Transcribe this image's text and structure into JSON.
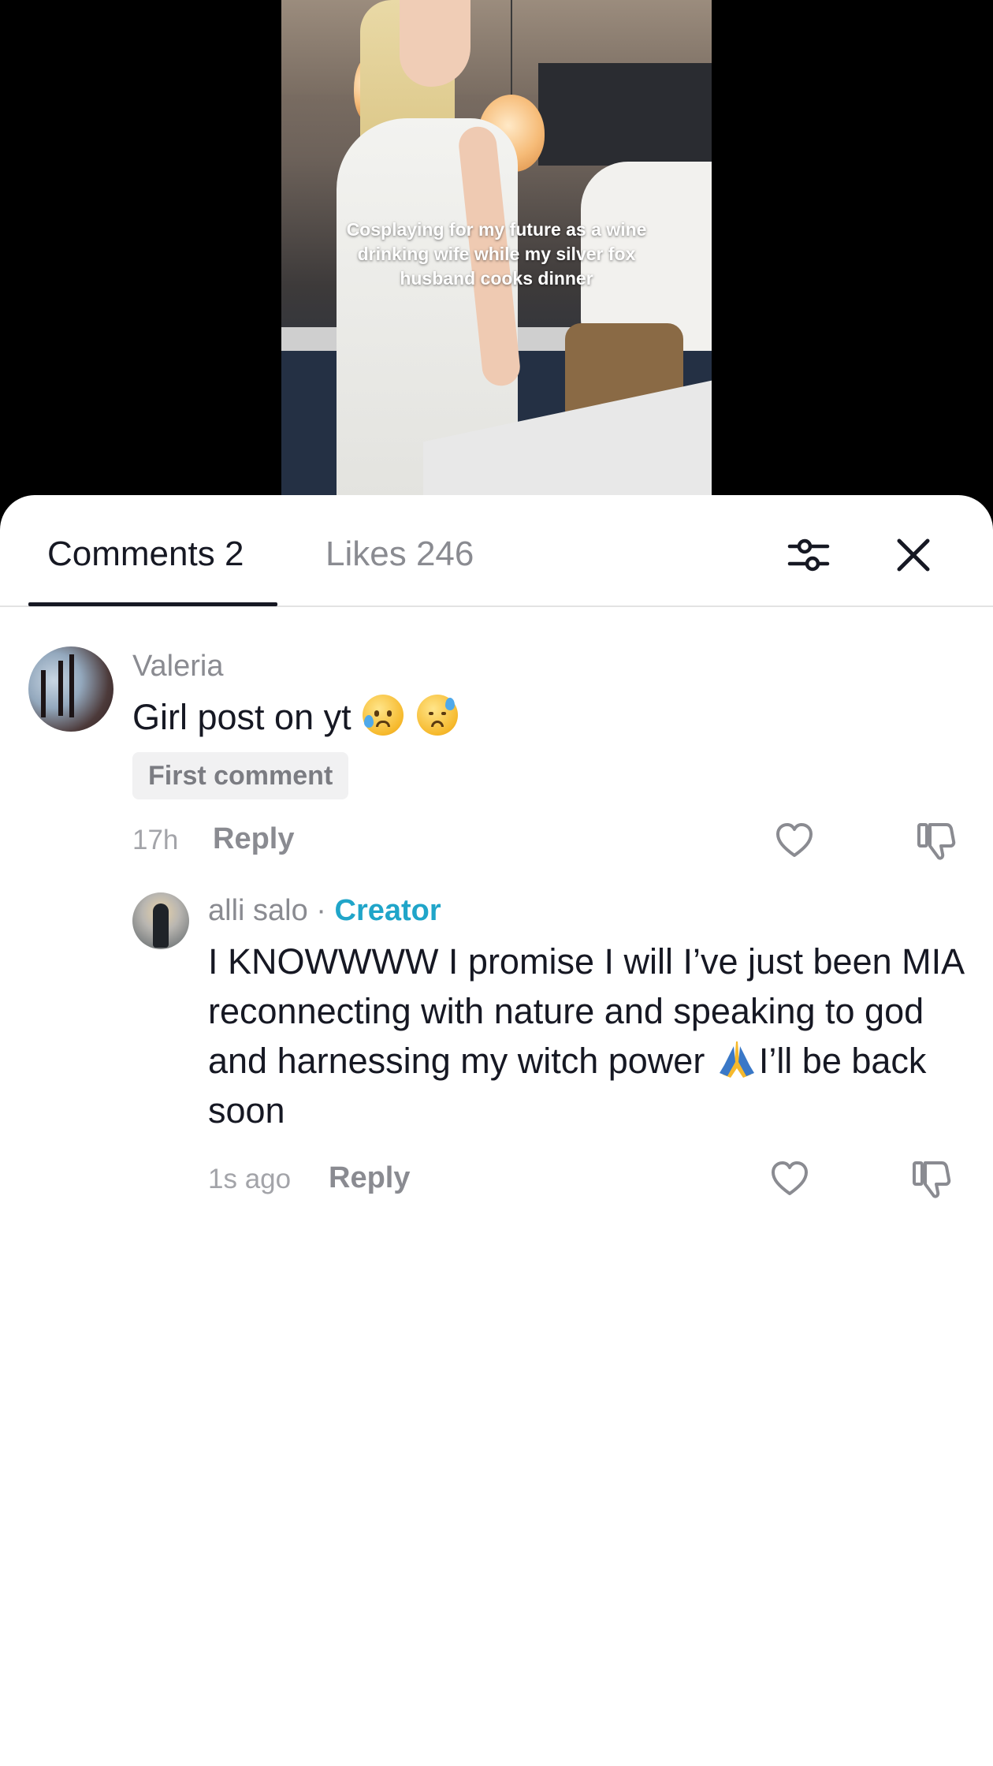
{
  "video": {
    "caption": "Cosplaying for my future as a wine drinking wife while my silver fox husband cooks dinner"
  },
  "tabs": {
    "comments_label": "Comments 2",
    "likes_label": "Likes 246"
  },
  "icons": {
    "filter": "sliders-icon",
    "close": "close-icon",
    "like": "heart-icon",
    "dislike": "thumbs-down-icon"
  },
  "comments": [
    {
      "username": "Valeria",
      "text": "Girl post on yt",
      "emoji": [
        "sad-sweat-emoji",
        "downcast-sweat-emoji"
      ],
      "badge": "First comment",
      "time": "17h",
      "reply_label": "Reply",
      "replies": [
        {
          "username": "alli salo",
          "separator": "·",
          "role": "Creator",
          "text_before": "I KNOWWWW I promise I will I’ve just been MIA reconnecting with nature and speaking to god and harnessing my witch power ",
          "text_after": "I’ll be back soon",
          "emoji": "folded-hands-emoji",
          "time": "1s ago",
          "reply_label": "Reply"
        }
      ]
    }
  ],
  "colors": {
    "accent_creator": "#20a5c9",
    "text_primary": "#161823",
    "text_secondary": "#8a8b91"
  }
}
